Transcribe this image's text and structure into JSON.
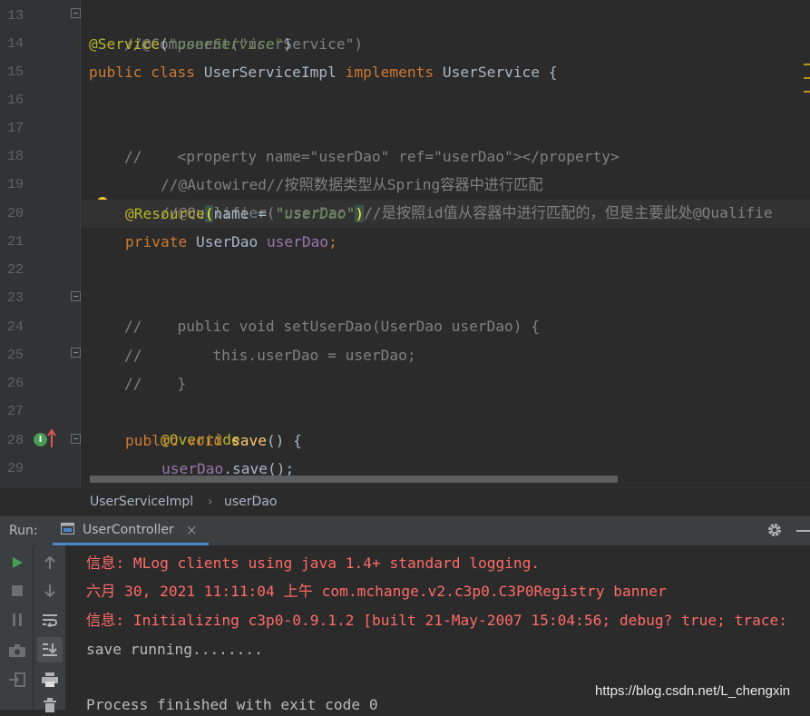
{
  "editor": {
    "line_numbers": [
      "13",
      "14",
      "15",
      "16",
      "17",
      "18",
      "19",
      "20",
      "21",
      "22",
      "23",
      "24",
      "25",
      "26",
      "27",
      "28",
      "29"
    ],
    "lines": {
      "l13": {
        "text": "//@Component(\"userService\")"
      },
      "l14": {
        "ann": "@Service",
        "p1": "(",
        "str": "\"userService\"",
        "p2": ")"
      },
      "l15": {
        "kw1": "public class ",
        "name": "UserServiceImpl ",
        "kw2": "implements ",
        "iface": "UserService {"
      },
      "l17": {
        "text": "//    <property name=\"userDao\" ref=\"userDao\"></property>"
      },
      "l18": {
        "text": "//@Autowired//按照数据类型从Spring容器中进行匹配"
      },
      "l19": {
        "text": "//@Qualifier(\"userDao\")//是按照id值从容器中进行匹配的，但是主要此处@Qualifie"
      },
      "l20": {
        "ann": "@Resource",
        "p1": "(",
        "param": "name = ",
        "str": "\"userDao\"",
        "p2": ")"
      },
      "l21": {
        "kw": "private ",
        "type": "UserDao ",
        "field": "userDao",
        "semi": ";"
      },
      "l23": {
        "text": "//    public void setUserDao(UserDao userDao) {"
      },
      "l24": {
        "text": "//        this.userDao = userDao;"
      },
      "l25": {
        "text": "//    }"
      },
      "l27": {
        "ann": "@Override"
      },
      "l28": {
        "kw": "public void ",
        "fn": "save",
        "rest": "() {"
      },
      "l29": {
        "field": "userDao",
        "rest": ".save();"
      }
    }
  },
  "breadcrumb": {
    "class_name": "UserServiceImpl",
    "separator": "›",
    "member": "userDao"
  },
  "run_panel": {
    "label": "Run:",
    "tab_label": "UserController",
    "tab_close": "×",
    "console_lines": [
      "信息: MLog clients using java 1.4+ standard logging.",
      "六月 30, 2021 11:11:04 上午 com.mchange.v2.c3p0.C3P0Registry banner",
      "信息: Initializing c3p0-0.9.1.2 [built 21-May-2007 15:04:56; debug? true; trace:",
      "save running........",
      "",
      "Process finished with exit code 0"
    ]
  },
  "watermark": "https://blog.csdn.net/L_chengxin",
  "icons": {
    "bulb": "lightbulb-icon",
    "implements": "implements-method-icon",
    "run": "run-icon",
    "stop": "stop-icon",
    "pause": "pause-icon",
    "camera": "camera-icon",
    "login": "exit-icon",
    "up": "arrow-up-icon",
    "down": "arrow-down-icon",
    "wrap": "soft-wrap-icon",
    "scroll_end": "scroll-to-end-icon",
    "print": "print-icon",
    "trash": "trash-icon",
    "settings": "gear-icon",
    "minimize": "minimize-icon"
  },
  "colors": {
    "keyword": "#cc7832",
    "string": "#6a8759",
    "annotation": "#bbb529",
    "comment": "#808080",
    "field": "#9876aa",
    "function": "#ffc66d",
    "error_text": "#ff6b68",
    "run_green": "#499c54",
    "accent_blue": "#4a88c7"
  }
}
